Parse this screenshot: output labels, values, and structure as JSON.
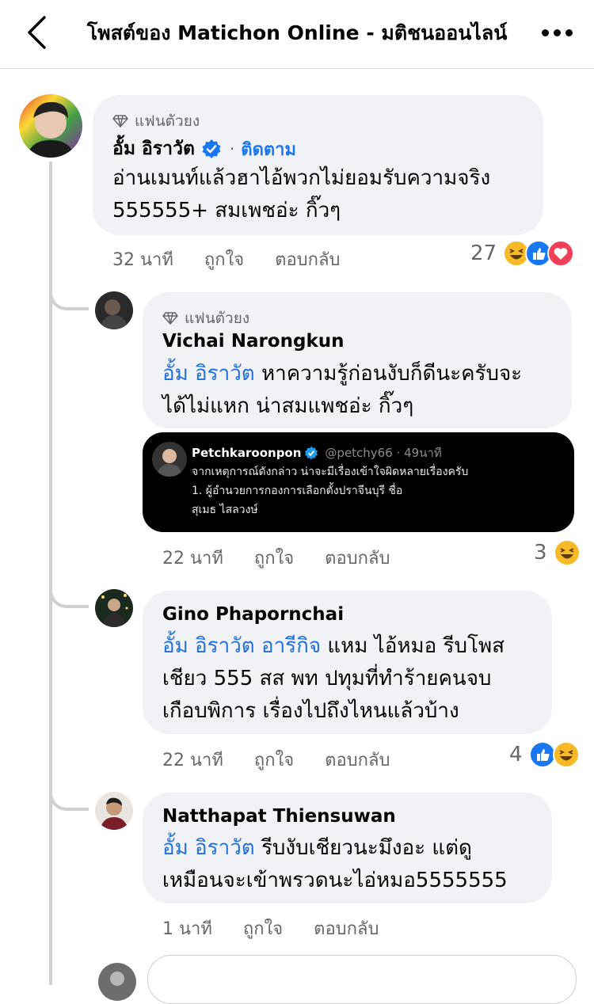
{
  "header": {
    "title": "โพสต์ของ Matichon Online - มติชนออนไลน์"
  },
  "comments": [
    {
      "badge": "แฟนตัวยง",
      "author": "อั้ม อิราวัต",
      "follow_label": "ติดตาม",
      "line1": "อ่านเมนท์แล้วฮาไอ้พวกไม่ยอมรับความจริง",
      "line2": "555555+ สมเพชอ่ะ กิ๊วๆ",
      "time": "32 นาที",
      "like_label": "ถูกใจ",
      "reply_label": "ตอบกลับ",
      "reaction_count": "27"
    },
    {
      "badge": "แฟนตัวยง",
      "author": "Vichai Narongkun",
      "mention": "อั้ม อิราวัต",
      "line1_rest": " หาความรู้ก่อนงับก็ดีนะครับจะ",
      "line2": "ได้ไม่แหก น่าสมแพชอ่ะ กิ๊วๆ",
      "time": "22 นาที",
      "like_label": "ถูกใจ",
      "reply_label": "ตอบกลับ",
      "reaction_count": "3"
    },
    {
      "author": "Gino Phapornchai",
      "mention": "อั้ม อิราวัต อารีกิจ",
      "line1_rest": " แหม ไอ้หมอ รีบโพส",
      "line2": "เชียว 555 สส พท ปทุมที่ทำร้ายคนจบ",
      "line3": "เกือบพิการ เรื่องไปถึงไหนแล้วบ้าง",
      "time": "22 นาที",
      "like_label": "ถูกใจ",
      "reply_label": "ตอบกลับ",
      "reaction_count": "4"
    },
    {
      "author": "Natthapat Thiensuwan",
      "mention": "อั้ม อิราวัต",
      "line1_rest": " รีบงับเชียวนะมึงอะ แต่ดู",
      "line2": "เหมือนจะเข้าพรวดนะไอ่หมอ5555555",
      "time": "1 นาที",
      "like_label": "ถูกใจ",
      "reply_label": "ตอบกลับ"
    }
  ],
  "embed": {
    "name": "Petchkaroonpon",
    "handle": "@petchy66 · 49นาที",
    "line1": "จากเหตุการณ์ดังกล่าว น่าจะมีเรื่องเข้าใจผิดหลายเรื่องครับ",
    "line2": "1. ผู้อำนวยการกองการเลือกตั้งปราจีนบุรี ชื่อ",
    "line3": "สุเมธ  ไสลวงษ์"
  },
  "colors": {
    "link": "#216fdb",
    "follow": "#1877f2",
    "bubble": "#f0f2f5",
    "meta": "#65676b",
    "like": "#1877f2",
    "love": "#f33e58",
    "haha": "#f7b928"
  }
}
